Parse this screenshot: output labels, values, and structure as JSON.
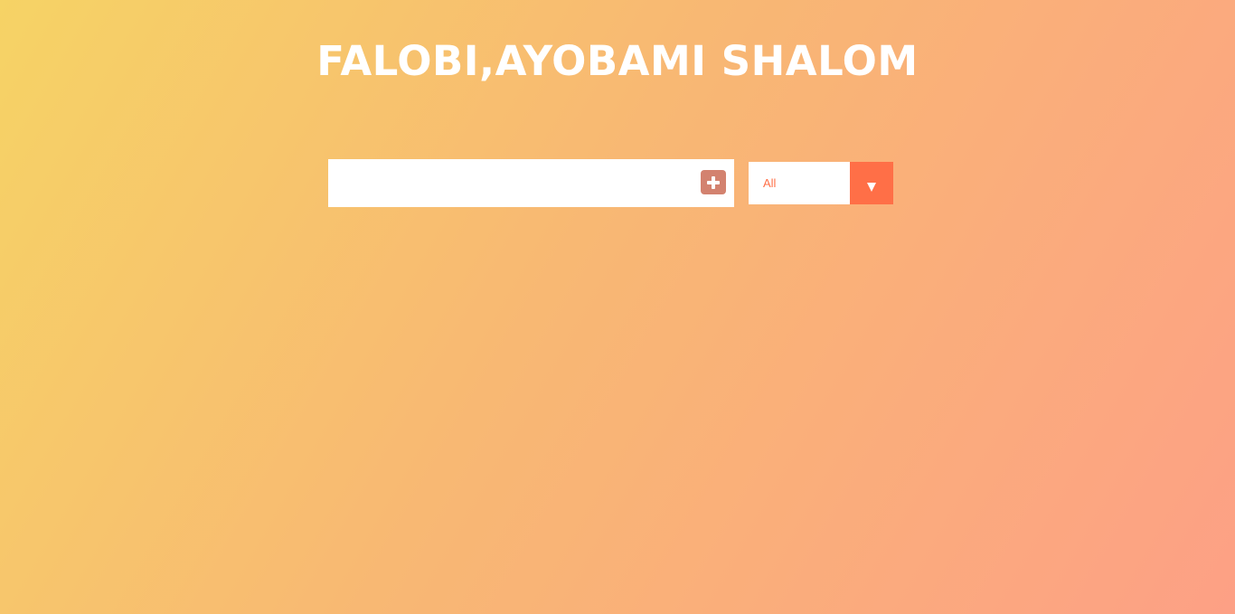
{
  "header": {
    "title": "FALOBI,AYOBAMI SHALOM"
  },
  "todo_form": {
    "input_value": "",
    "input_placeholder": "",
    "add_button_icon": "plus-icon"
  },
  "filter": {
    "selected": "All",
    "arrow_icon": "chevron-down-icon"
  },
  "colors": {
    "gradient_start": "#f6d365",
    "gradient_end": "#fda085",
    "accent": "#ff6f47",
    "add_button": "#d3826f"
  }
}
